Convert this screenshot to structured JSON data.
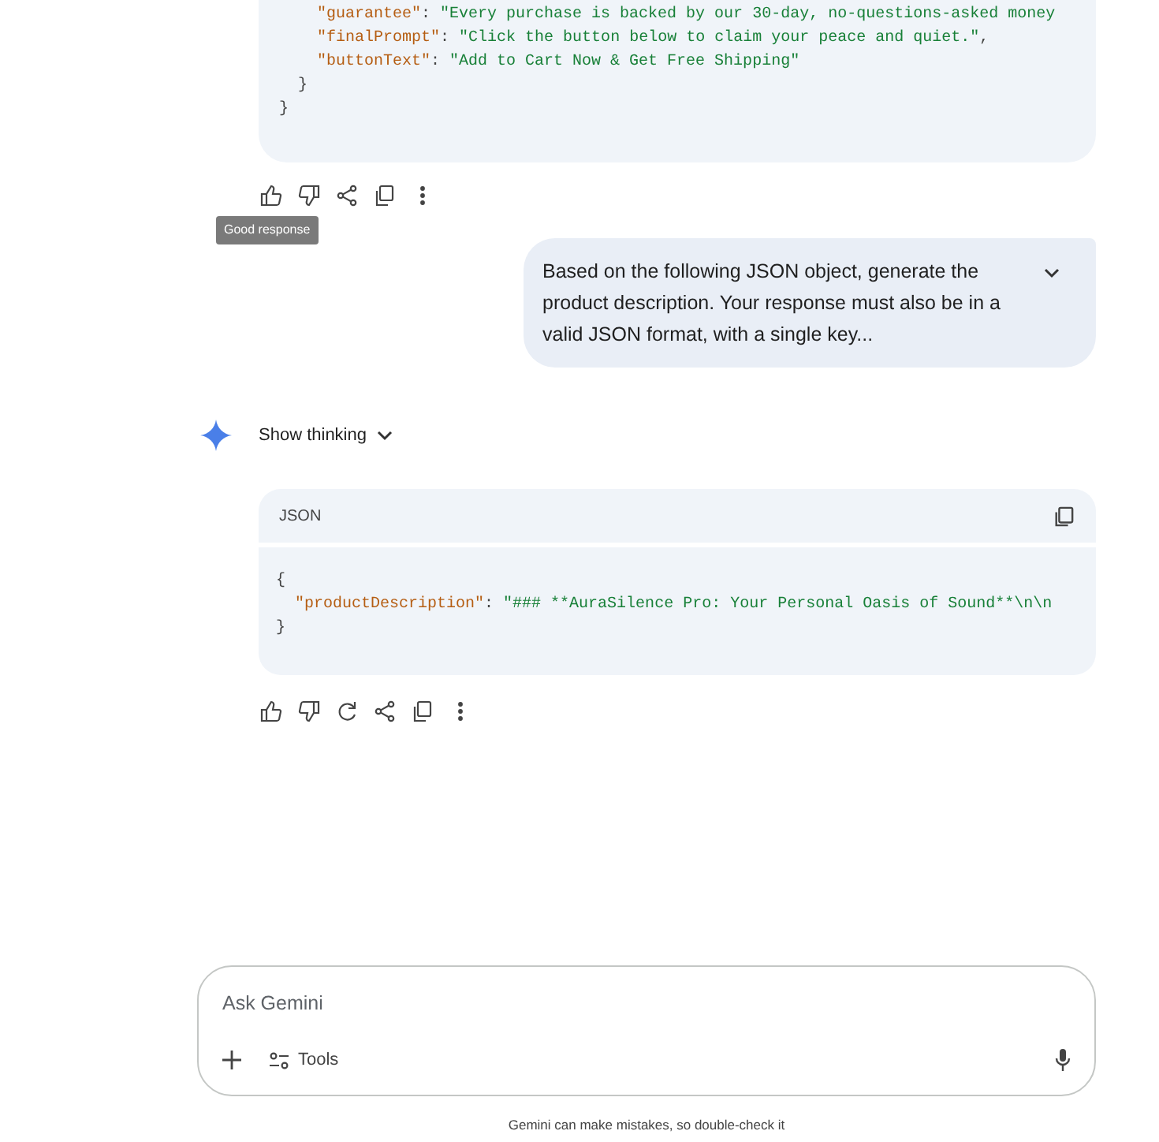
{
  "previous_response": {
    "code_lines": [
      [
        {
          "kind": "key",
          "text": "    \"guarantee\""
        },
        {
          "kind": "punct",
          "text": ": "
        },
        {
          "kind": "string",
          "text": "\"Every purchase is backed by our 30-day, no-questions-asked money"
        }
      ],
      [
        {
          "kind": "key",
          "text": "    \"finalPrompt\""
        },
        {
          "kind": "punct",
          "text": ": "
        },
        {
          "kind": "string",
          "text": "\"Click the button below to claim your peace and quiet.\""
        },
        {
          "kind": "punct",
          "text": ","
        }
      ],
      [
        {
          "kind": "key",
          "text": "    \"buttonText\""
        },
        {
          "kind": "punct",
          "text": ": "
        },
        {
          "kind": "string",
          "text": "\"Add to Cart Now & Get Free Shipping\""
        }
      ],
      [
        {
          "kind": "punct",
          "text": "  }"
        }
      ],
      [
        {
          "kind": "punct",
          "text": "}"
        }
      ]
    ],
    "tooltip": "Good response"
  },
  "user_message": {
    "text": "Based on the following JSON object, generate the product description. Your response must also be in a valid JSON format, with a single key...",
    "expanded": false
  },
  "thinking": {
    "label": "Show thinking",
    "expanded": false
  },
  "code_block": {
    "language": "JSON",
    "code_lines": [
      [
        {
          "kind": "punct",
          "text": "{"
        }
      ],
      [
        {
          "kind": "key",
          "text": "  \"productDescription\""
        },
        {
          "kind": "punct",
          "text": ": "
        },
        {
          "kind": "string",
          "text": "\"### **AuraSilence Pro: Your Personal Oasis of Sound**\\n\\n"
        }
      ],
      [
        {
          "kind": "punct",
          "text": "}"
        }
      ]
    ]
  },
  "input": {
    "placeholder": "Ask Gemini",
    "tools_label": "Tools"
  },
  "disclaimer": "Gemini can make mistakes, so double-check it"
}
